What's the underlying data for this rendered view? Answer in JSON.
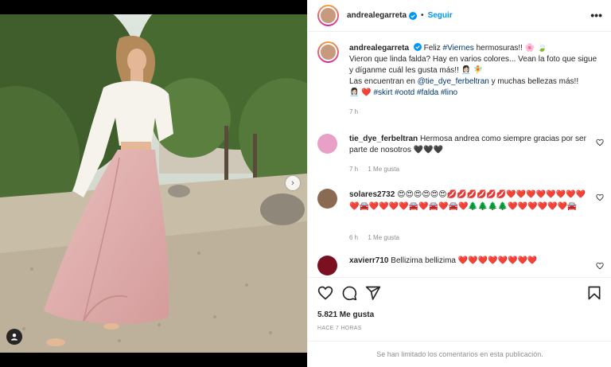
{
  "post": {
    "username": "andrealegarreta",
    "follow_label": "Seguir",
    "more_label": "•••",
    "caption": {
      "username": "andrealegarreta",
      "line1_pre": "Feliz ",
      "line1_tag": "#Viernes",
      "line1_post": " hermosuras!! 🌸 🍃",
      "line2": "Vieron que linda falda? Hay en varios colores... Vean la foto que sigue y díganme cuál les gusta más!! 👩🏻‍💼 🧚",
      "line3_pre": "Las encuentran en ",
      "line3_mention": "@tie_dye_ferbeltran",
      "line3_post": " y muchas bellezas más!!",
      "line4_emoji": "👩🏻‍💼 ❤️",
      "hashtags": "#skirt #ootd #falda #lino",
      "time": "7 h"
    },
    "comments": [
      {
        "username": "tie_dye_ferbeltran",
        "text": "Hermosa andrea como siempre gracias por ser parte de nosotros 🖤🖤🖤",
        "time": "7 h",
        "likes": "1 Me gusta",
        "avatar_color": "#e8a0c8"
      },
      {
        "username": "solares2732",
        "text": "😍😍😍😍😍😍💋💋💋💋💋💋❤️❤️❤️❤️❤️❤️❤️❤️❤️🚘❤️❤️❤️❤️🚘❤️🚘❤️🚘❤️🌲🌲🌲🌲❤️❤️❤️❤️❤️❤️🚘",
        "time": "6 h",
        "likes": "1 Me gusta",
        "avatar_color": "#8a6a52"
      },
      {
        "username": "xavierr710",
        "text": "Bellizima bellizima ❤️❤️❤️❤️❤️❤️❤️❤️",
        "avatar_color": "#7a1020"
      }
    ],
    "likes_count": "5.821 Me gusta",
    "time_ago": "HACE 7 HORAS",
    "comments_limited": "Se han limitado los comentarios en esta publicación."
  },
  "colors": {
    "follow_blue": "#0095f6",
    "link_blue": "#00376b",
    "muted_gray": "#8e8e8e",
    "text_dark": "#262626"
  },
  "icons": [
    "verified-badge-icon",
    "more-options-icon",
    "heart-icon",
    "comment-icon",
    "share-icon",
    "bookmark-icon",
    "user-tag-icon",
    "carousel-next-icon"
  ]
}
